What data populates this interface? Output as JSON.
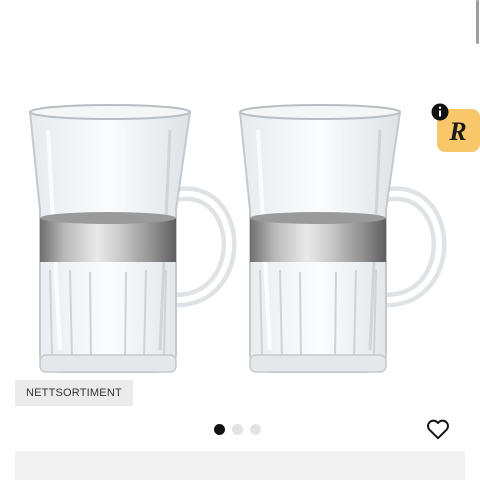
{
  "product": {
    "badge_label": "NETTSORTIMENT",
    "image_icon": "glass-mugs-pair-image"
  },
  "gallery": {
    "total_images": 3,
    "active_index": 1
  },
  "actions": {
    "favorite_icon": "heart-outline-icon"
  },
  "extension": {
    "info_icon": "info-icon",
    "letter": "R"
  },
  "colors": {
    "badge_bg": "#ebebeb",
    "active_dot": "#111111",
    "inactive_dot": "#e3e3e3",
    "extension_bg": "#f7c76a"
  }
}
